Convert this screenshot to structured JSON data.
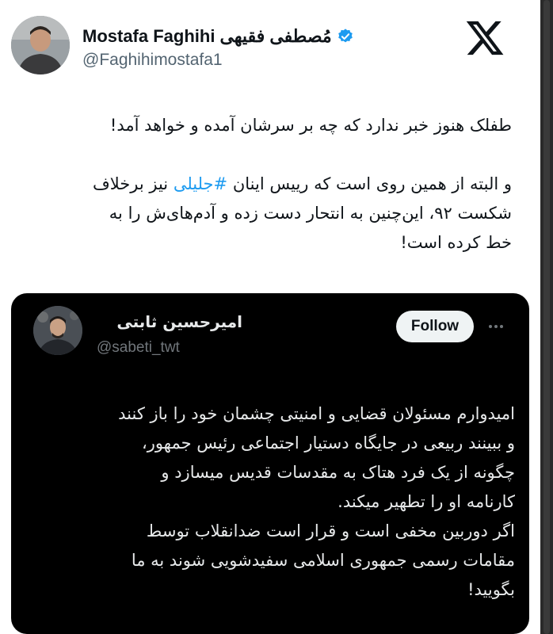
{
  "author": {
    "display_name": "Mostafa Faghihi",
    "display_name_fa": "مُصطفی فقیهی",
    "handle": "@Faghihimostafa1",
    "verified": true
  },
  "tweet": {
    "line1": "طفلک هنوز خبر ندارد که چه بر سرشان آمده و خواهد آمد!",
    "line2_before": "و البته از همین روی است که رییس اینان ",
    "hashtag": "#جلیلی",
    "line2_after": " نیز برخلاف",
    "line3": "شکست ۹۲، این‌چنین به انتحار دست زده و آدم‌های‌ش را به",
    "line4": "خط کرده است!"
  },
  "quoted": {
    "display_name": "امیرحسین ثابتی",
    "handle": "@sabeti_twt",
    "follow_label": "Follow",
    "lines": [
      "امیدوارم مسئولان قضایی و امنیتی چشمان خود را باز کنند",
      "و ببینند ربیعی در جایگاه دستیار اجتماعی رئیس جمهور،",
      "چگونه از یک فرد هتاک به مقدسات قدیس میسازد و",
      "کارنامه او را تطهیر میکند.",
      "اگر دوربین مخفی است و قرار است ضدانقلاب توسط",
      "مقامات رسمی جمهوری اسلامی سفیدشویی شوند به ما",
      "بگویید!"
    ]
  },
  "icons": {
    "verified": "verified-badge-icon",
    "logo": "x-logo-icon",
    "more": "more-options-icon"
  },
  "colors": {
    "link": "#1d9bf0",
    "verified": "#1d9bf0"
  }
}
